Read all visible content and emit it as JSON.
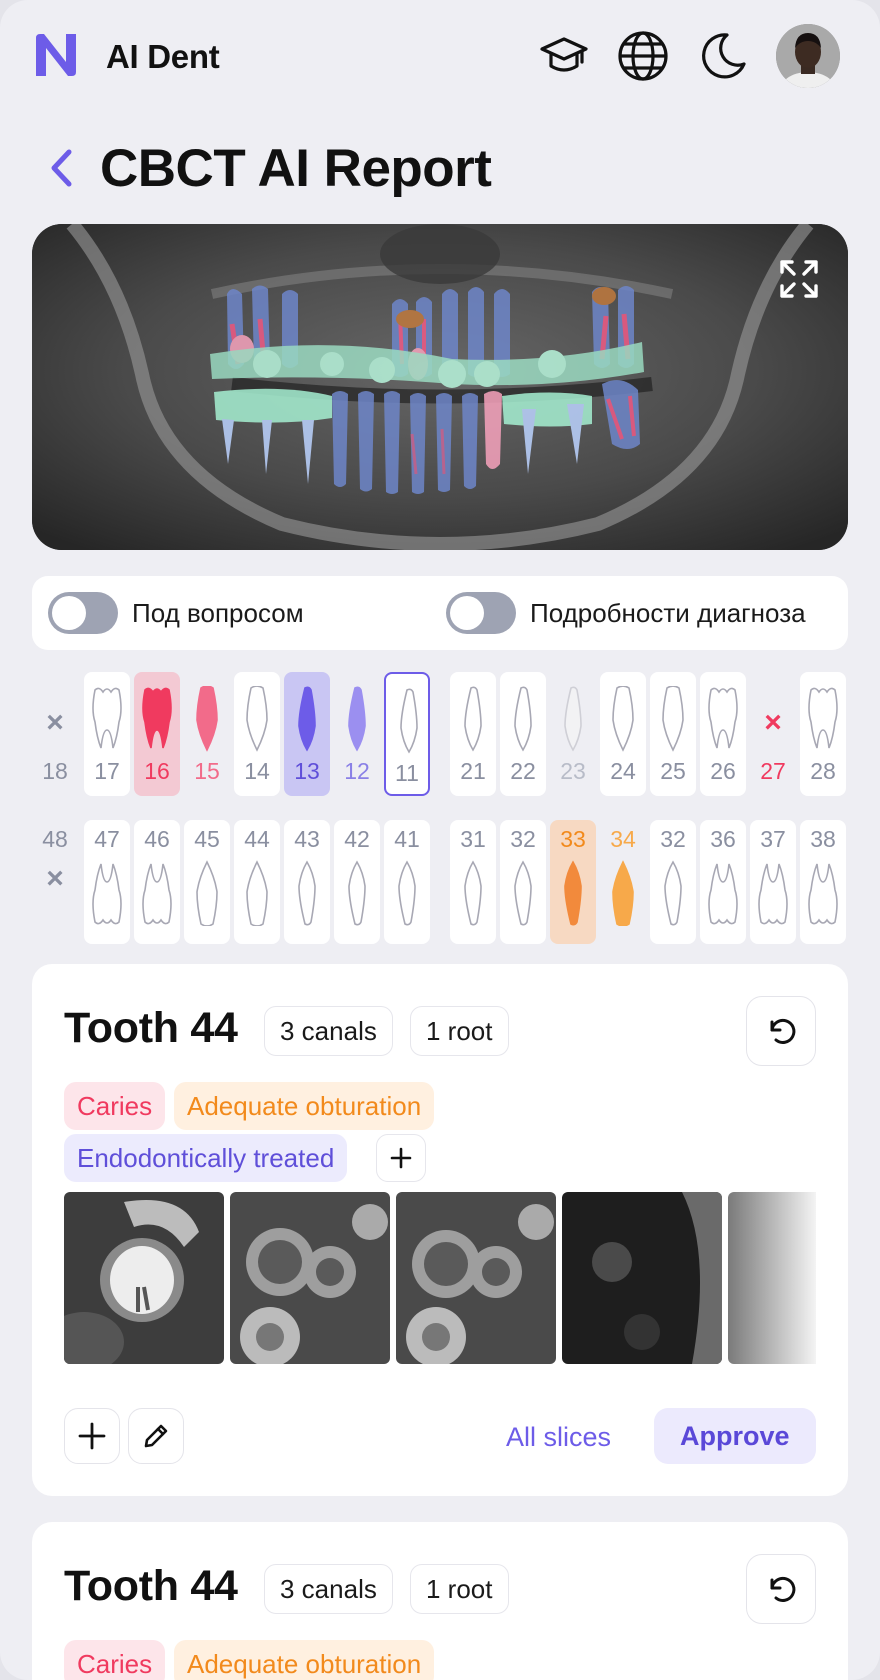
{
  "header": {
    "app_title": "AI Dent",
    "icons": [
      "graduation-cap-icon",
      "globe-icon",
      "moon-icon"
    ]
  },
  "page": {
    "title": "CBCT AI Report"
  },
  "toggles": {
    "questionable": {
      "label": "Под вопросом",
      "on": false
    },
    "details": {
      "label": "Подробности диагноза",
      "on": false
    }
  },
  "teeth": {
    "upper": [
      {
        "n": "18",
        "state": "missing"
      },
      {
        "n": "17",
        "state": "normal"
      },
      {
        "n": "16",
        "state": "caries"
      },
      {
        "n": "15",
        "state": "caries-light"
      },
      {
        "n": "14",
        "state": "normal"
      },
      {
        "n": "13",
        "state": "endo"
      },
      {
        "n": "12",
        "state": "endo-light"
      },
      {
        "n": "11",
        "state": "selected"
      },
      {
        "n": "21",
        "state": "normal"
      },
      {
        "n": "22",
        "state": "normal"
      },
      {
        "n": "23",
        "state": "faded"
      },
      {
        "n": "24",
        "state": "normal"
      },
      {
        "n": "25",
        "state": "normal"
      },
      {
        "n": "26",
        "state": "normal"
      },
      {
        "n": "27",
        "state": "missing-red"
      },
      {
        "n": "28",
        "state": "normal"
      }
    ],
    "lower": [
      {
        "n": "48",
        "state": "missing"
      },
      {
        "n": "47",
        "state": "normal"
      },
      {
        "n": "46",
        "state": "normal"
      },
      {
        "n": "45",
        "state": "normal"
      },
      {
        "n": "44",
        "state": "normal"
      },
      {
        "n": "43",
        "state": "normal"
      },
      {
        "n": "42",
        "state": "normal"
      },
      {
        "n": "41",
        "state": "normal"
      },
      {
        "n": "31",
        "state": "normal"
      },
      {
        "n": "32",
        "state": "normal"
      },
      {
        "n": "33",
        "state": "orange"
      },
      {
        "n": "34",
        "state": "orange-light"
      },
      {
        "n": "32",
        "state": "normal"
      },
      {
        "n": "36",
        "state": "normal"
      },
      {
        "n": "37",
        "state": "normal"
      },
      {
        "n": "38",
        "state": "normal"
      }
    ]
  },
  "cards": [
    {
      "title": "Tooth 44",
      "canals": "3 canals",
      "roots": "1 root",
      "tags": [
        "Caries",
        "Adequate obturation",
        "Endodontically treated"
      ],
      "all_slices": "All slices",
      "approve": "Approve"
    },
    {
      "title": "Tooth 44",
      "canals": "3 canals",
      "roots": "1 root",
      "tags": [
        "Caries",
        "Adequate obturation"
      ]
    }
  ],
  "colors": {
    "accent": "#6d5ce8",
    "caries": "#f03a5f",
    "caries_bg": "#fde5ea",
    "obturation": "#f28a1c",
    "obturation_bg": "#fff0e0",
    "endo": "#5f4fd9",
    "endo_bg": "#ecebfd"
  }
}
